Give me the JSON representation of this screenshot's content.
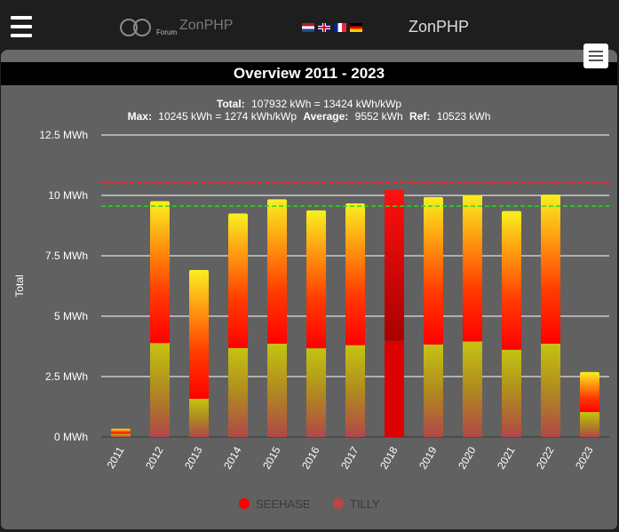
{
  "header": {
    "logo_text": "ZonPHP",
    "logo_sub": "Forum",
    "brand": "ZonPHP",
    "flags": [
      {
        "lang": "nl",
        "colors": [
          "#ae1c28",
          "#ffffff",
          "#21468b"
        ]
      },
      {
        "lang": "en",
        "colors": [
          "#012169",
          "#ffffff",
          "#c8102e"
        ]
      },
      {
        "lang": "fr",
        "colors": [
          "#002395",
          "#ffffff",
          "#ed2939"
        ]
      },
      {
        "lang": "de",
        "colors": [
          "#000000",
          "#dd0000",
          "#ffce00"
        ]
      }
    ]
  },
  "panel": {
    "title": "Overview 2011 - 2023"
  },
  "summary": {
    "line1": {
      "label": "Total:",
      "value": "107932 kWh = 13424 kWh/kWp"
    },
    "line2": [
      {
        "label": "Max:",
        "value": "10245 kWh = 1274 kWh/kWp"
      },
      {
        "label": "Average:",
        "value": "9552 kWh"
      },
      {
        "label": "Ref:",
        "value": "10523 kWh"
      }
    ]
  },
  "chart_data": {
    "type": "bar",
    "stacked": true,
    "categories": [
      "2011",
      "2012",
      "2013",
      "2014",
      "2015",
      "2016",
      "2017",
      "2018",
      "2019",
      "2020",
      "2021",
      "2022",
      "2023"
    ],
    "series": [
      {
        "name": "SEEHASE",
        "color": "#ff0000",
        "values": [
          0.21,
          5.87,
          5.33,
          5.57,
          5.98,
          5.71,
          5.87,
          6.25,
          6.1,
          6.07,
          5.74,
          6.17,
          1.66
        ]
      },
      {
        "name": "TILLY",
        "color": "#bb4444",
        "values": [
          0.13,
          3.89,
          1.58,
          3.68,
          3.86,
          3.67,
          3.8,
          3.98,
          3.83,
          3.95,
          3.61,
          3.86,
          1.03
        ]
      }
    ],
    "highlight_category": "2018",
    "ylabel": "Total",
    "unit": "MWh",
    "ylim": [
      0,
      12.5
    ],
    "yticks": [
      0,
      2.5,
      5,
      7.5,
      10,
      12.5
    ],
    "ytick_labels": [
      "0 MWh",
      "2.5 MWh",
      "5 MWh",
      "7.5 MWh",
      "10 MWh",
      "12.5 MWh"
    ],
    "reference_lines": [
      {
        "value": 10.523,
        "color": "#ff2020"
      },
      {
        "value": 9.552,
        "color": "#22dd22"
      }
    ],
    "grid": true,
    "legend_position": "bottom"
  }
}
